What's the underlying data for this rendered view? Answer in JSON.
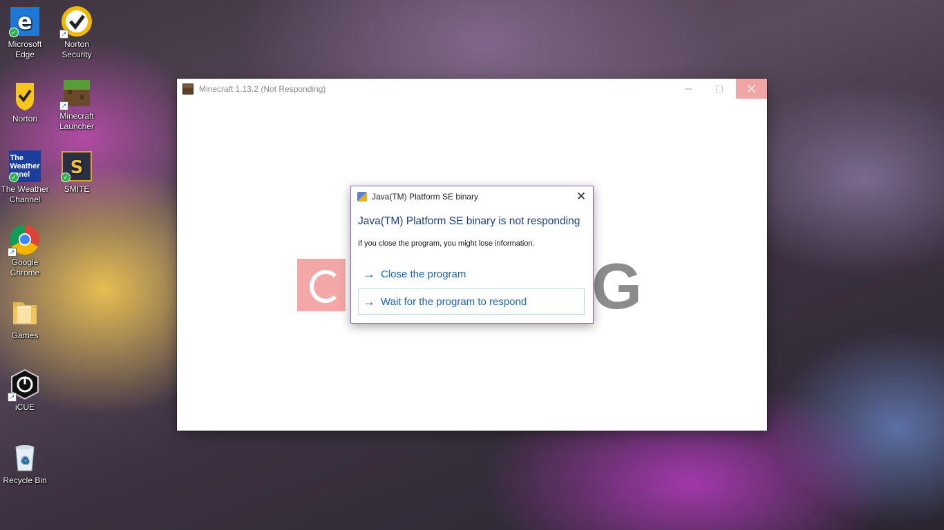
{
  "desktop": {
    "icons": [
      {
        "label": "Microsoft Edge",
        "icon": "edge-icon"
      },
      {
        "label": "Norton Security",
        "icon": "norton-icon"
      },
      {
        "label": "Norton",
        "icon": "norton-icon"
      },
      {
        "label": "Minecraft Launcher",
        "icon": "minecraft-icon"
      },
      {
        "label": "The Weather Channel",
        "icon": "weather-icon"
      },
      {
        "label": "SMITE",
        "icon": "smite-icon"
      },
      {
        "label": "Google Chrome",
        "icon": "chrome-icon"
      },
      {
        "label": "Games",
        "icon": "folder-icon"
      },
      {
        "label": "iCUE",
        "icon": "icue-icon"
      },
      {
        "label": "Recycle Bin",
        "icon": "recycle-bin-icon"
      }
    ],
    "weather_tile_text": "The Weather annel"
  },
  "minecraft_window": {
    "title": "Minecraft 1.13.2 (Not Responding)",
    "splash_letter": "G"
  },
  "dialog": {
    "title": "Java(TM) Platform SE binary",
    "heading": "Java(TM) Platform SE binary is not responding",
    "message": "If you close the program, you might lose information.",
    "option_close": "Close the program",
    "option_wait": "Wait for the program to respond",
    "close_glyph": "✕"
  },
  "colors": {
    "dialog_border": "#9b5fd1",
    "heading": "#1b3d8c",
    "link": "#1e64b4",
    "close_button_hover": "#f1a6a6"
  }
}
